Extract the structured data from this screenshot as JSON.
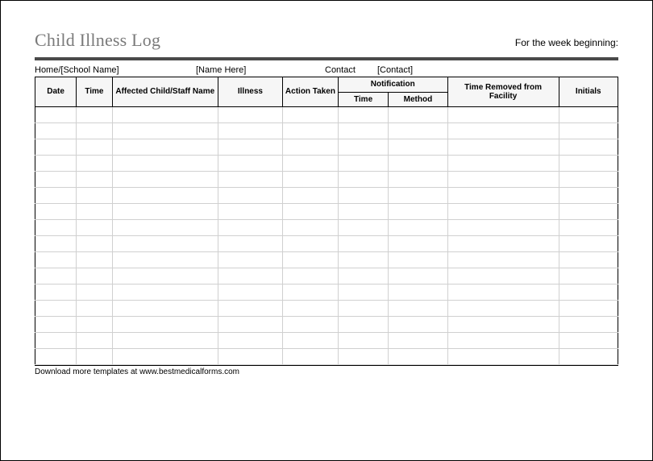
{
  "title": "Child Illness Log",
  "week_label": "For the week beginning:",
  "info": {
    "home_label": "Home/[School Name]",
    "home_value": "[Name Here]",
    "contact_label": "Contact",
    "contact_value": "[Contact]"
  },
  "columns": {
    "date": "Date",
    "time": "Time",
    "name": "Affected Child/Staff Name",
    "illness": "Illness",
    "action": "Action Taken",
    "notification": "Notification",
    "notif_time": "Time",
    "notif_method": "Method",
    "removed": "Time Removed from Facility",
    "initials": "Initials"
  },
  "row_count": 16,
  "footer": "Download more templates at www.bestmedicalforms.com"
}
